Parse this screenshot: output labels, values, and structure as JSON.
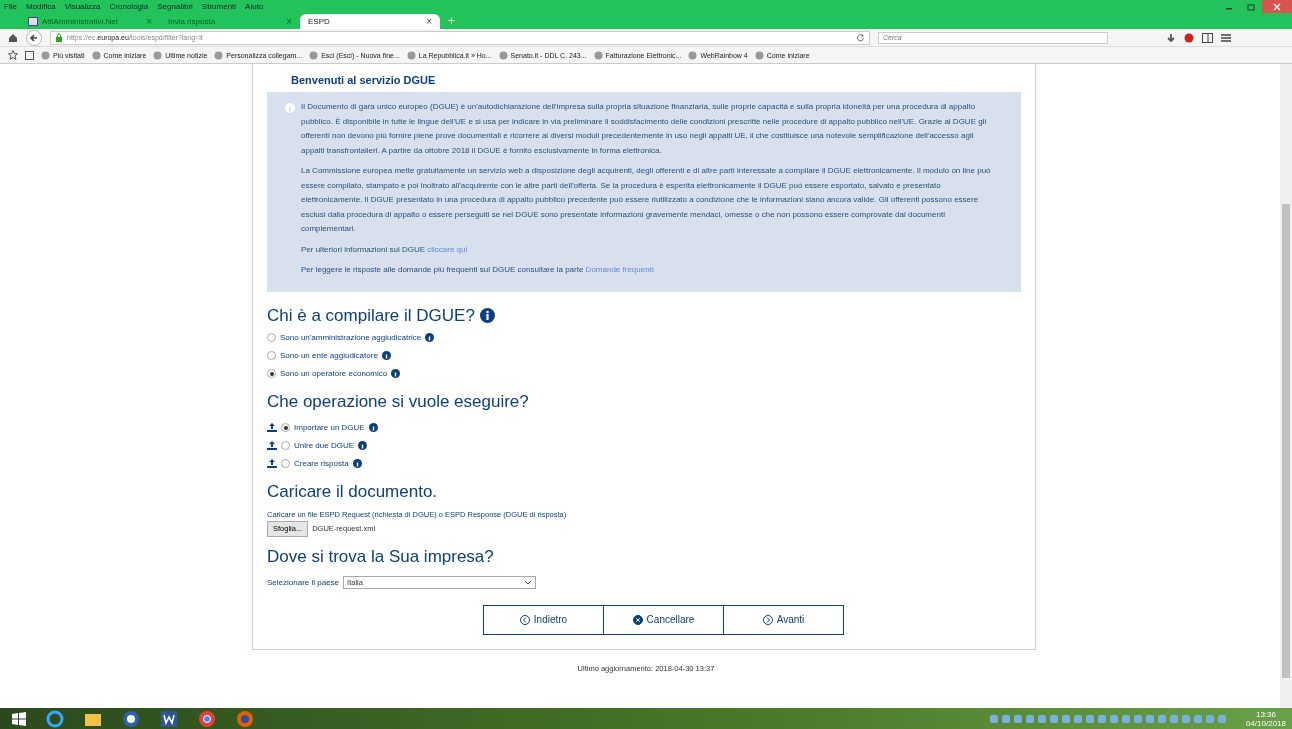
{
  "menu_bar": [
    "File",
    "Modifica",
    "Visualizza",
    "Cronologia",
    "Segnalibri",
    "Strumenti",
    "Aiuto"
  ],
  "tabs": [
    {
      "label": "AttiAmministrativi.Net",
      "close": "×",
      "selected": false
    },
    {
      "label": "Invia risposta",
      "close": "×",
      "selected": false
    },
    {
      "label": "ESPD",
      "close": "×",
      "selected": true
    }
  ],
  "new_tab": "+",
  "address": {
    "prefix": "https://ec.",
    "domain": "europa.eu",
    "suffix": "/tools/espd/filter?lang=it"
  },
  "search": {
    "placeholder": "Cerca"
  },
  "bookmarks": [
    "Più visitati",
    "Come iniziare",
    "Ultime notizie",
    "Personalizza collegam...",
    "Esci (Esci) - Nuova fine...",
    "La Repubblica.it » Ho...",
    "Senato.it - DDL C. 243...",
    "Fatturazione Elettronic...",
    "WebRainbow 4",
    "Come iniziare"
  ],
  "page": {
    "title": "Benvenuti al servizio DGUE",
    "intro": [
      "Il Documento di gara unico europeo (DGUE) è un'autodichiarazione dell'impresa sulla propria situazione finanziaria, sulle proprie capacità e sulla propria idoneità per una procedura di appalto pubblico. È disponibile in tutte le lingue dell'UE e si usa per indicare in via preliminare il soddisfacimento delle condizioni prescritte nelle procedure di appalto pubblico nell'UE. Grazie al DGUE gli offerenti non devono più fornire piene prove documentali e ricorrere ai diversi moduli precedentemente in uso negli appalti UE, il che costituisce una notevole semplificazione dell'accesso agli appalti transfrontalieri. A partire da ottobre 2018 il DGUE è fornito esclusivamente in forma elettronica.",
      "La Commissione europea mette gratuitamente un servizio web a disposizione degli acquirenti, degli offerenti e di altre parti interessate a compilare il DGUE elettronicamente. Il modulo on line può essere compilato, stampato e poi inoltrato all'acquirente con le altre parti dell'offerta. Se la procedura è esperita elettronicamente il DGUE può essere esportato, salvato e presentato elettronicamente. Il DGUE presentato in una procedura di appalto pubblico precedente può essere riutilizzato a condizione che le informazioni siano ancora valide. Gli offerenti possono essere esclusi dalla procedura di appalto o essere perseguiti se nel DGUE sono presentate informazioni gravemente mendaci, omesse o che non possono essere comprovate dai documenti complementari."
    ],
    "links": [
      {
        "text": "Per ulteriori informazioni sul DGUE",
        "link": "cliccare qui"
      },
      {
        "text": "Per leggere le risposte alle domande più frequenti sul DGUE consultare la parte",
        "link": "Domande frequenti"
      }
    ],
    "who": {
      "heading": "Chi è a compilare il DGUE?",
      "options": [
        {
          "label": "Sono un'amministrazione aggiudicatrice",
          "selected": false
        },
        {
          "label": "Sono un ente aggiudicatore",
          "selected": false
        },
        {
          "label": "Sono un operatore economico",
          "selected": true
        }
      ]
    },
    "operation": {
      "heading": "Che operazione si vuole eseguire?",
      "options": [
        {
          "label": "Importare un DGUE",
          "selected": true
        },
        {
          "label": "Unire due DGUE",
          "selected": false
        },
        {
          "label": "Creare risposta",
          "selected": false
        }
      ]
    },
    "upload": {
      "heading": "Caricare il documento.",
      "hint": "Caricare un file ESPD Request (richiesta di DGUE) o ESPD Response (DGUE di risposta)",
      "button": "Sfoglia...",
      "filename": "DGUE-request.xml"
    },
    "country": {
      "heading": "Dove si trova la Sua impresa?",
      "label": "Selezionare il paese",
      "value": "Italia"
    },
    "buttons": [
      "Indietro",
      "Cancellare",
      "Avanti"
    ],
    "footer": "Ultimo aggiornamento: 2018-04-30 13:37"
  },
  "clock": {
    "time": "13:36",
    "date": "04/10/2018"
  }
}
